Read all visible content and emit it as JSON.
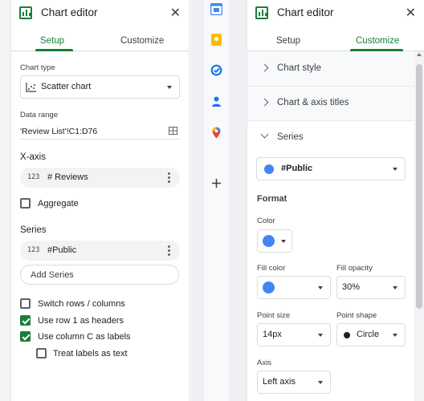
{
  "left_editor": {
    "title": "Chart editor",
    "close_glyph": "✕",
    "tabs": [
      {
        "label": "Setup",
        "active": true
      },
      {
        "label": "Customize",
        "active": false
      }
    ],
    "chart_type_label": "Chart type",
    "chart_type_value": "Scatter chart",
    "data_range_label": "Data range",
    "data_range_value": "'Review List'!C1:D76",
    "x_axis_title": "X-axis",
    "x_axis_field": "# Reviews",
    "aggregate_label": "Aggregate",
    "series_title": "Series",
    "series_field": "#Public",
    "add_series_label": "Add Series",
    "number_icon_text": "123",
    "checkboxes": [
      {
        "label": "Switch rows / columns",
        "checked": false
      },
      {
        "label": "Use row 1 as headers",
        "checked": true
      },
      {
        "label": "Use column C as labels",
        "checked": true
      },
      {
        "label": "Treat labels as text",
        "checked": false
      }
    ]
  },
  "right_editor": {
    "title": "Chart editor",
    "close_glyph": "✕",
    "tabs": [
      {
        "label": "Setup",
        "active": false
      },
      {
        "label": "Customize",
        "active": true
      }
    ],
    "sections": [
      {
        "label": "Chart style",
        "expanded": false
      },
      {
        "label": "Chart & axis titles",
        "expanded": false
      },
      {
        "label": "Series",
        "expanded": true
      }
    ],
    "series_select_value": "#Public",
    "format_title": "Format",
    "color_label": "Color",
    "fill_color_label": "Fill color",
    "fill_opacity_label": "Fill opacity",
    "fill_opacity_value": "30%",
    "point_size_label": "Point size",
    "point_size_value": "14px",
    "point_shape_label": "Point shape",
    "point_shape_value": "Circle",
    "axis_label": "Axis",
    "axis_value": "Left axis"
  },
  "colors": {
    "accent": "#188038",
    "series_color": "#4285f4"
  },
  "side_panel_icons": [
    "calendar-icon",
    "keep-icon",
    "tasks-icon",
    "contacts-icon",
    "maps-icon",
    "add-icon"
  ]
}
